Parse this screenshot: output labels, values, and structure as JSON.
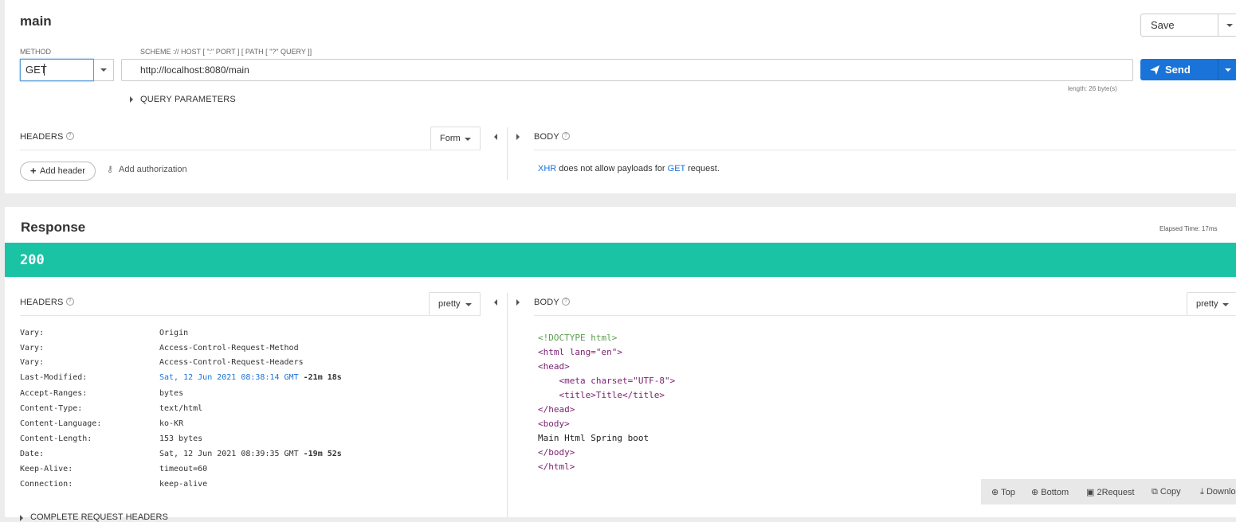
{
  "request": {
    "title": "main",
    "save_label": "Save",
    "method_label": "METHOD",
    "method_value": "GET",
    "scheme_label": "SCHEME :// HOST [ \":\" PORT ] [ PATH [ \"?\" QUERY ]]",
    "url": "http://localhost:8080/main",
    "send_label": "Send",
    "length_text": "length: 26 byte(s)",
    "query_params_label": "QUERY PARAMETERS",
    "headers_label": "HEADERS",
    "form_label": "Form",
    "body_label": "BODY",
    "add_header_label": "Add header",
    "add_authorization_label": "Add authorization",
    "body_message": {
      "xhr": "XHR",
      "middle": " does not allow payloads for ",
      "method": "GET",
      "end": " request."
    }
  },
  "response": {
    "title": "Response",
    "elapsed": "Elapsed Time: 17ms",
    "status_code": "200",
    "headers_label": "HEADERS",
    "headers_mode": "pretty",
    "body_label": "BODY",
    "body_mode": "pretty",
    "headers": [
      {
        "name": "Vary:",
        "value": "Origin",
        "age": ""
      },
      {
        "name": "Vary:",
        "value": "Access-Control-Request-Method",
        "age": ""
      },
      {
        "name": "Vary:",
        "value": "Access-Control-Request-Headers",
        "age": ""
      },
      {
        "name": "Last-Modified:",
        "value": "Sat, 12 Jun 2021 08:38:14 GMT",
        "age": " -21m 18s"
      },
      {
        "name": "Accept-Ranges:",
        "value": "bytes",
        "age": ""
      },
      {
        "name": "Content-Type:",
        "value": "text/html",
        "age": ""
      },
      {
        "name": "Content-Language:",
        "value": "ko-KR",
        "age": ""
      },
      {
        "name": "Content-Length:",
        "value": "153 bytes",
        "age": ""
      },
      {
        "name": "Date:",
        "value": "Sat, 12 Jun 2021 08:39:35 GMT",
        "age": " -19m 52s"
      },
      {
        "name": "Keep-Alive:",
        "value": "timeout=60",
        "age": ""
      },
      {
        "name": "Connection:",
        "value": "keep-alive",
        "age": ""
      }
    ],
    "complete_headers_label": "COMPLETE REQUEST HEADERS",
    "body_lines": [
      "<!DOCTYPE html>",
      "<html lang=\"en\">",
      "<head>",
      "    <meta charset=\"UTF-8\">",
      "    <title>Title</title>",
      "</head>",
      "<body>",
      "Main Html Spring boot",
      "</body>",
      "</html>"
    ],
    "toolbar": {
      "top": "Top",
      "bottom": "Bottom",
      "to_request": "2Request",
      "copy": "Copy",
      "download": "Download"
    }
  }
}
